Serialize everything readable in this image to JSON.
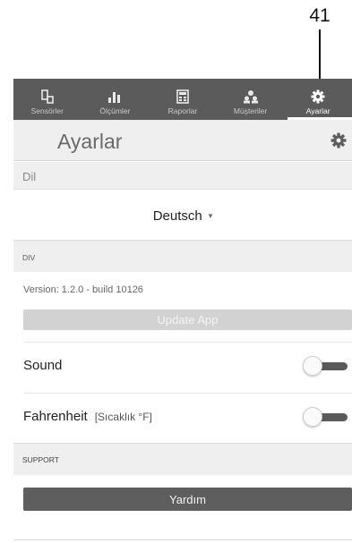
{
  "callout": {
    "number": "41"
  },
  "tabs": [
    {
      "label": "Sensörler",
      "icon": "sensor-icon",
      "active": false
    },
    {
      "label": "Ölçümler",
      "icon": "bar-chart-icon",
      "active": false
    },
    {
      "label": "Raporlar",
      "icon": "report-icon",
      "active": false
    },
    {
      "label": "Müşteriler",
      "icon": "customers-icon",
      "active": false
    },
    {
      "label": "Ayarlar",
      "icon": "gear-icon",
      "active": true
    }
  ],
  "header": {
    "title": "Ayarlar",
    "icon": "gear-icon"
  },
  "language": {
    "section_label": "Dil",
    "selected": "Deutsch",
    "caret": "▾"
  },
  "div_section": {
    "label": "DIV",
    "version": "Version: 1.2.0 - build 10126",
    "update_button": "Update App"
  },
  "settings": {
    "sound": {
      "label": "Sound",
      "enabled": false
    },
    "fahrenheit": {
      "label": "Fahrenheit",
      "sublabel": "[Sıcaklık °F]",
      "enabled": false
    }
  },
  "support": {
    "label": "SUPPORT",
    "help_button": "Yardım"
  },
  "colors": {
    "tabbar": "#5b5b5b",
    "header_bg": "#efefef",
    "toggle_track": "#5a5a5a",
    "help_button": "#5e5e5e",
    "update_button": "#d2d2d2"
  }
}
